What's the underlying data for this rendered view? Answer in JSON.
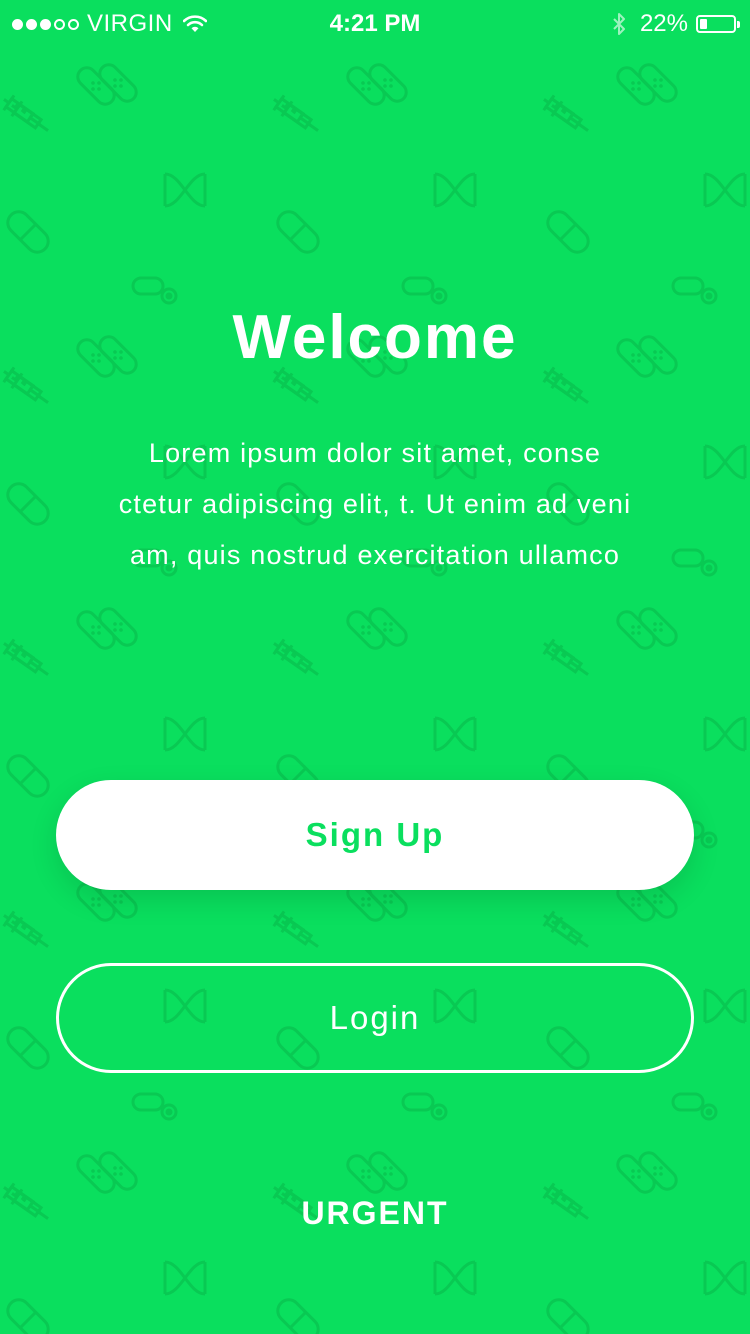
{
  "status_bar": {
    "carrier": "VIRGIN",
    "time": "4:21 PM",
    "battery_percent": "22%",
    "battery_level": 0.22,
    "signal_bars_filled": 3,
    "signal_bars_total": 5
  },
  "icons": {
    "wifi": "wifi-icon",
    "bluetooth": "bluetooth-icon",
    "battery": "battery-icon",
    "pattern": [
      "bandage-icon",
      "syringe-icon",
      "dna-icon",
      "pill-icon",
      "pill-bottle-icon"
    ]
  },
  "colors": {
    "background": "#0adf5e",
    "pattern": "#09c953",
    "button_fill": "#ffffff",
    "button_text": "#0adf5e",
    "text": "#ffffff"
  },
  "welcome": {
    "title": "Welcome",
    "lines": [
      "Lorem ipsum dolor sit amet, conse",
      "ctetur adipiscing elit, t. Ut enim ad veni",
      "am, quis nostrud exercitation ullamco"
    ]
  },
  "actions": {
    "signup_label": "Sign Up",
    "login_label": "Login",
    "urgent_label": "URGENT"
  }
}
